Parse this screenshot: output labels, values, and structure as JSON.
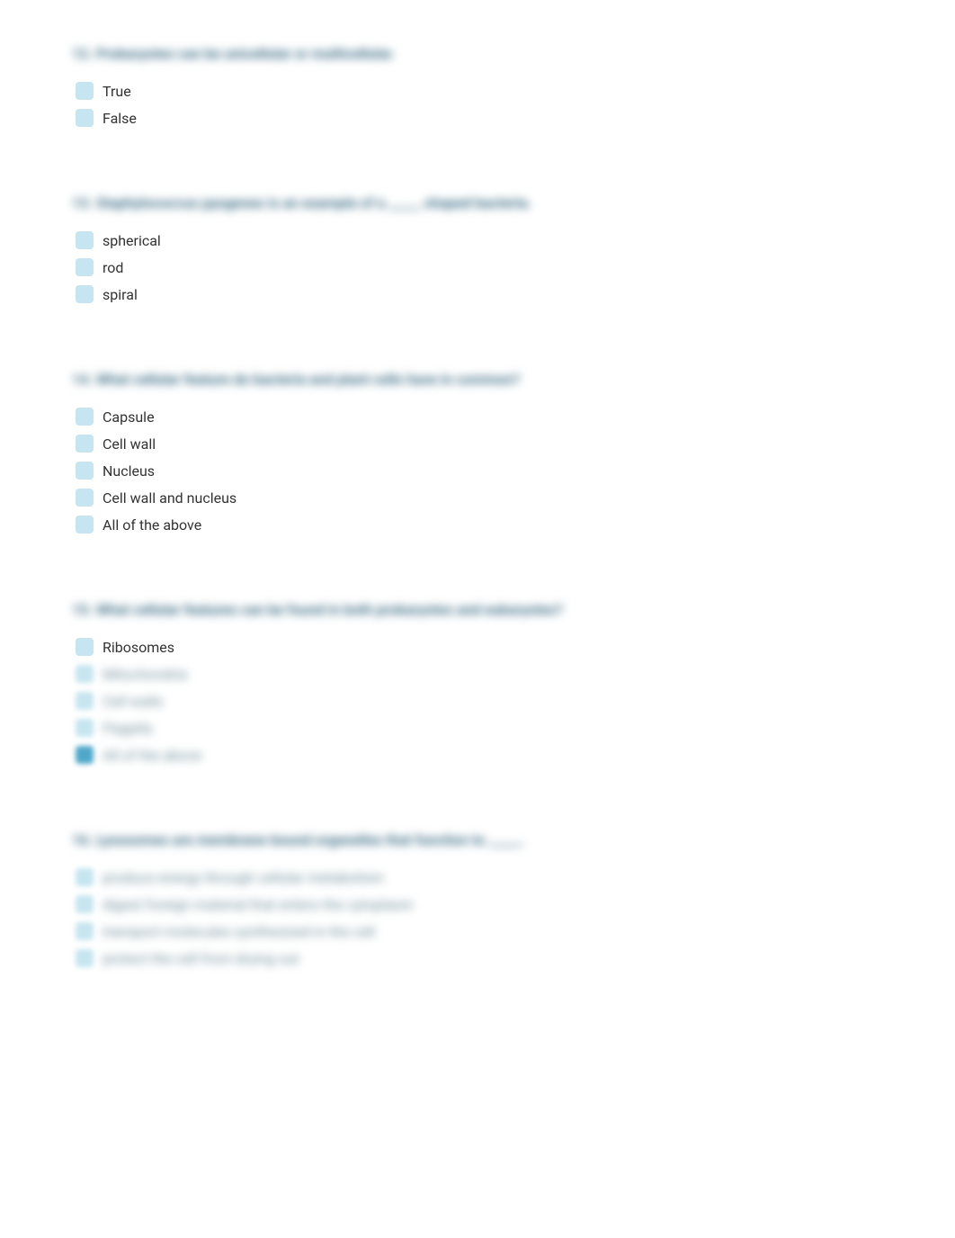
{
  "questions": [
    {
      "text": "12. Prokaryotes can be unicellular or multicellular.",
      "options": [
        {
          "label": "True",
          "blurred": false,
          "filled": false
        },
        {
          "label": "False",
          "blurred": false,
          "filled": false
        }
      ]
    },
    {
      "text": "13. Staphylococcus pyogenes is an example of a _____ shaped bacteria.",
      "options": [
        {
          "label": "spherical",
          "blurred": false,
          "filled": false
        },
        {
          "label": "rod",
          "blurred": false,
          "filled": false
        },
        {
          "label": "spiral",
          "blurred": false,
          "filled": false
        }
      ]
    },
    {
      "text": "14. What cellular feature do bacteria and plant cells have in common?",
      "options": [
        {
          "label": "Capsule",
          "blurred": false,
          "filled": false
        },
        {
          "label": "Cell wall",
          "blurred": false,
          "filled": false
        },
        {
          "label": "Nucleus",
          "blurred": false,
          "filled": false
        },
        {
          "label": "Cell wall and nucleus",
          "blurred": false,
          "filled": false
        },
        {
          "label": "All of the above",
          "blurred": false,
          "filled": false
        }
      ]
    },
    {
      "text": "15. What cellular features can be found in both prokaryotes and eukaryotes?",
      "options": [
        {
          "label": "Ribosomes",
          "blurred": false,
          "filled": false
        },
        {
          "label": "Mitochondria",
          "blurred": true,
          "filled": false
        },
        {
          "label": "Cell walls",
          "blurred": true,
          "filled": false
        },
        {
          "label": "Flagella",
          "blurred": true,
          "filled": false
        },
        {
          "label": "All of the above",
          "blurred": true,
          "filled": true
        }
      ]
    },
    {
      "text": "16. Lysosomes are membrane-bound organelles that function to _____.",
      "options": [
        {
          "label": "produce energy through cellular metabolism",
          "blurred": true,
          "filled": false
        },
        {
          "label": "digest foreign material that enters the cytoplasm",
          "blurred": true,
          "filled": false
        },
        {
          "label": "transport molecules synthesized in the cell",
          "blurred": true,
          "filled": false
        },
        {
          "label": "protect the cell from drying out",
          "blurred": true,
          "filled": false
        }
      ]
    }
  ]
}
